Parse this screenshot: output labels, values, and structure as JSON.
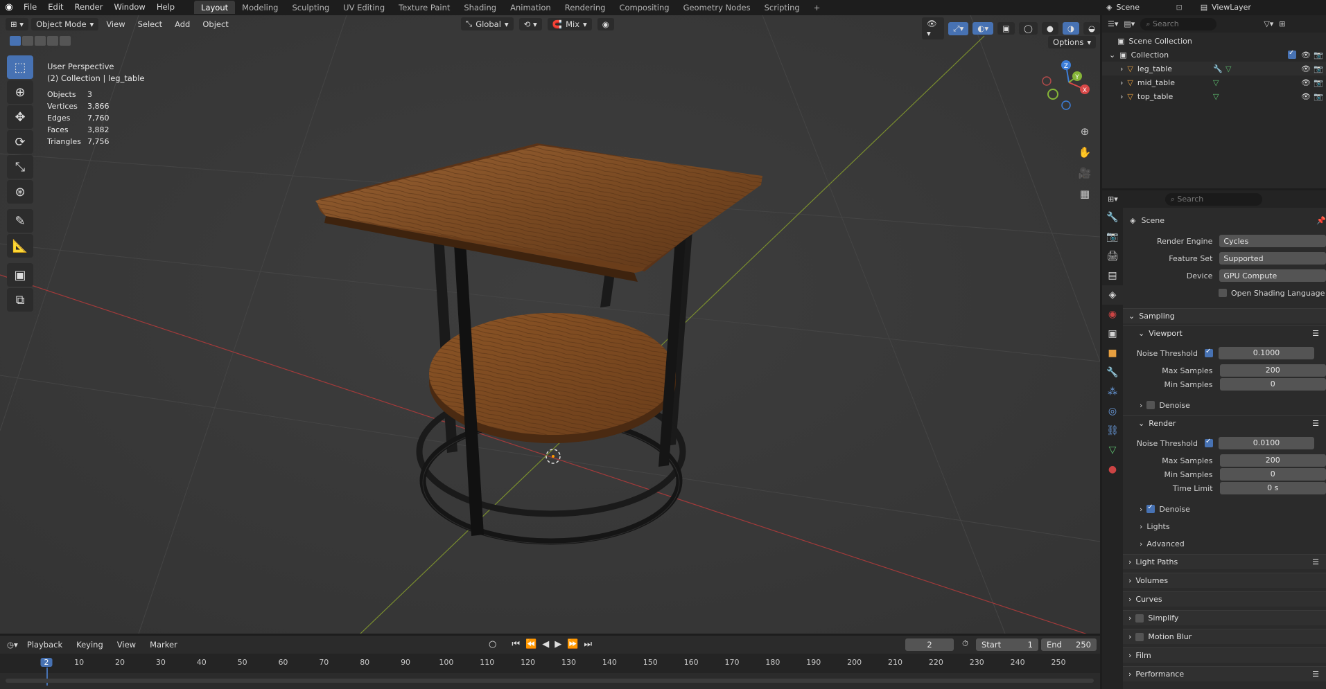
{
  "topbar": {
    "menus": [
      "File",
      "Edit",
      "Render",
      "Window",
      "Help"
    ],
    "workspaces": [
      "Layout",
      "Modeling",
      "Sculpting",
      "UV Editing",
      "Texture Paint",
      "Shading",
      "Animation",
      "Rendering",
      "Compositing",
      "Geometry Nodes",
      "Scripting"
    ],
    "active_workspace": "Layout",
    "add_tab": "+",
    "scene": "Scene",
    "view_layer": "ViewLayer"
  },
  "viewport_header": {
    "mode": "Object Mode",
    "menus": [
      "View",
      "Select",
      "Add",
      "Object"
    ],
    "orientation": "Global",
    "pivot": "Mix",
    "options_label": "Options"
  },
  "overlay": {
    "view_name": "User Perspective",
    "collection": "(2) Collection | leg_table",
    "stats": [
      {
        "k": "Objects",
        "v": "3"
      },
      {
        "k": "Vertices",
        "v": "3,866"
      },
      {
        "k": "Edges",
        "v": "7,760"
      },
      {
        "k": "Faces",
        "v": "3,882"
      },
      {
        "k": "Triangles",
        "v": "7,756"
      }
    ]
  },
  "gizmo": {
    "x": "X",
    "y": "Y",
    "z": "Z"
  },
  "outliner": {
    "search_placeholder": "Search",
    "root": "Scene Collection",
    "collection": "Collection",
    "objects": [
      "leg_table",
      "mid_table",
      "top_table"
    ]
  },
  "properties": {
    "search_placeholder": "Search",
    "context": "Scene",
    "render_engine_label": "Render Engine",
    "render_engine": "Cycles",
    "feature_set_label": "Feature Set",
    "feature_set": "Supported",
    "device_label": "Device",
    "device": "GPU Compute",
    "osl_label": "Open Shading Language",
    "sampling": "Sampling",
    "viewport": "Viewport",
    "noise_threshold_label": "Noise Threshold",
    "vp_noise": "0.1000",
    "max_samples_label": "Max Samples",
    "vp_max": "200",
    "min_samples_label": "Min Samples",
    "vp_min": "0",
    "denoise": "Denoise",
    "render": "Render",
    "r_noise": "0.0100",
    "r_max": "200",
    "r_min": "0",
    "time_limit_label": "Time Limit",
    "time_limit": "0 s",
    "lights": "Lights",
    "advanced": "Advanced",
    "sections": [
      "Light Paths",
      "Volumes",
      "Curves",
      "Simplify",
      "Motion Blur",
      "Film",
      "Performance"
    ]
  },
  "timeline": {
    "menus": [
      "Playback",
      "Keying",
      "View",
      "Marker"
    ],
    "current_frame": "2",
    "start_label": "Start",
    "start": "1",
    "end_label": "End",
    "end": "250",
    "ticks": [
      "2",
      "10",
      "20",
      "30",
      "40",
      "50",
      "60",
      "70",
      "80",
      "90",
      "100",
      "110",
      "120",
      "130",
      "140",
      "150",
      "160",
      "170",
      "180",
      "190",
      "200",
      "210",
      "220",
      "230",
      "240",
      "250"
    ]
  }
}
